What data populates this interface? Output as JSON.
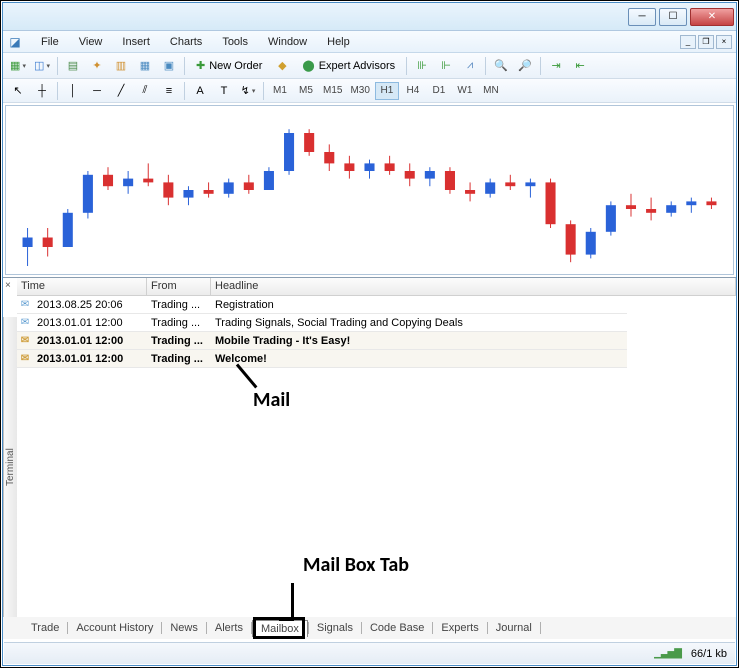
{
  "menu": {
    "file": "File",
    "view": "View",
    "insert": "Insert",
    "charts": "Charts",
    "tools": "Tools",
    "window": "Window",
    "help": "Help"
  },
  "toolbar": {
    "new_order": "New Order",
    "expert_advisors": "Expert Advisors"
  },
  "timeframes": {
    "m1": "M1",
    "m5": "M5",
    "m15": "M15",
    "m30": "M30",
    "h1": "H1",
    "h4": "H4",
    "d1": "D1",
    "w1": "W1",
    "mn": "MN"
  },
  "terminal": {
    "side_label": "Terminal",
    "headers": {
      "time": "Time",
      "from": "From",
      "headline": "Headline"
    },
    "rows": [
      {
        "read": true,
        "time": "2013.08.25 20:06",
        "from": "Trading ...",
        "headline": "Registration"
      },
      {
        "read": true,
        "time": "2013.01.01 12:00",
        "from": "Trading ...",
        "headline": "Trading Signals, Social Trading and Copying Deals"
      },
      {
        "read": false,
        "time": "2013.01.01 12:00",
        "from": "Trading ...",
        "headline": "Mobile Trading - It's Easy!"
      },
      {
        "read": false,
        "time": "2013.01.01 12:00",
        "from": "Trading ...",
        "headline": "Welcome!"
      }
    ],
    "tabs": {
      "trade": "Trade",
      "account_history": "Account History",
      "news": "News",
      "alerts": "Alerts",
      "mailbox": "Mailbox",
      "signals": "Signals",
      "code_base": "Code Base",
      "experts": "Experts",
      "journal": "Journal"
    }
  },
  "status": {
    "kb": "66/1 kb"
  },
  "annotations": {
    "mail": "Mail",
    "mailbox_tab": "Mail Box Tab"
  },
  "chart_data": {
    "type": "candlestick",
    "note": "approximate OHLC shape of the visible price chart",
    "series": [
      {
        "o": 100,
        "h": 101,
        "l": 99,
        "c": 100.5,
        "color": "blue"
      },
      {
        "o": 100.5,
        "h": 101,
        "l": 99.5,
        "c": 100,
        "color": "red"
      },
      {
        "o": 100,
        "h": 102,
        "l": 100,
        "c": 101.8,
        "color": "blue"
      },
      {
        "o": 101.8,
        "h": 104,
        "l": 101.5,
        "c": 103.8,
        "color": "blue"
      },
      {
        "o": 103.8,
        "h": 104.2,
        "l": 103,
        "c": 103.2,
        "color": "red"
      },
      {
        "o": 103.2,
        "h": 104,
        "l": 102.8,
        "c": 103.6,
        "color": "blue"
      },
      {
        "o": 103.6,
        "h": 104.4,
        "l": 103.2,
        "c": 103.4,
        "color": "red"
      },
      {
        "o": 103.4,
        "h": 103.8,
        "l": 102.2,
        "c": 102.6,
        "color": "red"
      },
      {
        "o": 102.6,
        "h": 103.2,
        "l": 102.2,
        "c": 103,
        "color": "blue"
      },
      {
        "o": 103,
        "h": 103.4,
        "l": 102.6,
        "c": 102.8,
        "color": "red"
      },
      {
        "o": 102.8,
        "h": 103.6,
        "l": 102.6,
        "c": 103.4,
        "color": "blue"
      },
      {
        "o": 103.4,
        "h": 103.8,
        "l": 102.8,
        "c": 103,
        "color": "red"
      },
      {
        "o": 103,
        "h": 104.2,
        "l": 103,
        "c": 104,
        "color": "blue"
      },
      {
        "o": 104,
        "h": 106.2,
        "l": 103.8,
        "c": 106,
        "color": "blue"
      },
      {
        "o": 106,
        "h": 106.2,
        "l": 104.8,
        "c": 105,
        "color": "red"
      },
      {
        "o": 105,
        "h": 105.4,
        "l": 104,
        "c": 104.4,
        "color": "red"
      },
      {
        "o": 104.4,
        "h": 104.8,
        "l": 103.6,
        "c": 104,
        "color": "red"
      },
      {
        "o": 104,
        "h": 104.6,
        "l": 103.6,
        "c": 104.4,
        "color": "blue"
      },
      {
        "o": 104.4,
        "h": 104.8,
        "l": 103.8,
        "c": 104,
        "color": "red"
      },
      {
        "o": 104,
        "h": 104.4,
        "l": 103.2,
        "c": 103.6,
        "color": "red"
      },
      {
        "o": 103.6,
        "h": 104.2,
        "l": 103.2,
        "c": 104,
        "color": "blue"
      },
      {
        "o": 104,
        "h": 104.2,
        "l": 102.8,
        "c": 103,
        "color": "red"
      },
      {
        "o": 103,
        "h": 103.4,
        "l": 102.4,
        "c": 102.8,
        "color": "red"
      },
      {
        "o": 102.8,
        "h": 103.6,
        "l": 102.6,
        "c": 103.4,
        "color": "blue"
      },
      {
        "o": 103.4,
        "h": 103.8,
        "l": 103,
        "c": 103.2,
        "color": "red"
      },
      {
        "o": 103.2,
        "h": 103.6,
        "l": 102.6,
        "c": 103.4,
        "color": "blue"
      },
      {
        "o": 103.4,
        "h": 103.6,
        "l": 101,
        "c": 101.2,
        "color": "red"
      },
      {
        "o": 101.2,
        "h": 101.4,
        "l": 99.2,
        "c": 99.6,
        "color": "red"
      },
      {
        "o": 99.6,
        "h": 101,
        "l": 99.4,
        "c": 100.8,
        "color": "blue"
      },
      {
        "o": 100.8,
        "h": 102.4,
        "l": 100.6,
        "c": 102.2,
        "color": "blue"
      },
      {
        "o": 102.2,
        "h": 102.8,
        "l": 101.6,
        "c": 102,
        "color": "red"
      },
      {
        "o": 102,
        "h": 102.6,
        "l": 101.4,
        "c": 101.8,
        "color": "red"
      },
      {
        "o": 101.8,
        "h": 102.4,
        "l": 101.6,
        "c": 102.2,
        "color": "blue"
      },
      {
        "o": 102.2,
        "h": 102.6,
        "l": 101.8,
        "c": 102.4,
        "color": "blue"
      },
      {
        "o": 102.4,
        "h": 102.6,
        "l": 102,
        "c": 102.2,
        "color": "red"
      }
    ],
    "ylim": [
      99,
      107
    ]
  }
}
